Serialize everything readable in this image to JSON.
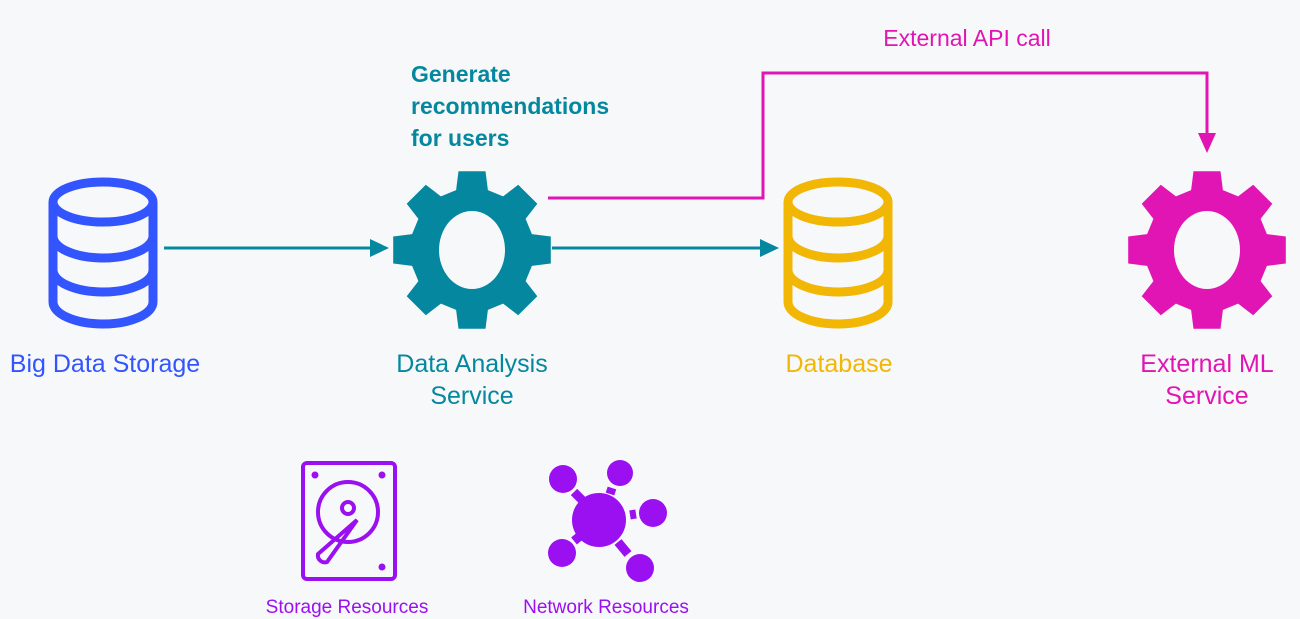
{
  "colors": {
    "blue": "#3355ff",
    "teal": "#05889f",
    "yellow": "#f2b705",
    "magenta": "#e015b4",
    "purple": "#9b10f0",
    "background": "#f7f8f9"
  },
  "nodes": {
    "big_data_storage": {
      "label": "Big Data Storage",
      "icon": "database-icon"
    },
    "data_analysis": {
      "label_line1": "Data Analysis",
      "label_line2": "Service",
      "icon": "gear-icon"
    },
    "database": {
      "label": "Database",
      "icon": "database-icon"
    },
    "external_ml": {
      "label_line1": "External ML",
      "label_line2": "Service",
      "icon": "gear-icon"
    }
  },
  "annotations": {
    "recommendations": {
      "line1": "Generate",
      "line2": "recommendations",
      "line3": "for users"
    },
    "api_call": "External API call"
  },
  "legend": {
    "storage": {
      "label": "Storage Resources",
      "icon": "hard-drive-icon"
    },
    "network": {
      "label": "Network Resources",
      "icon": "network-icon"
    }
  }
}
